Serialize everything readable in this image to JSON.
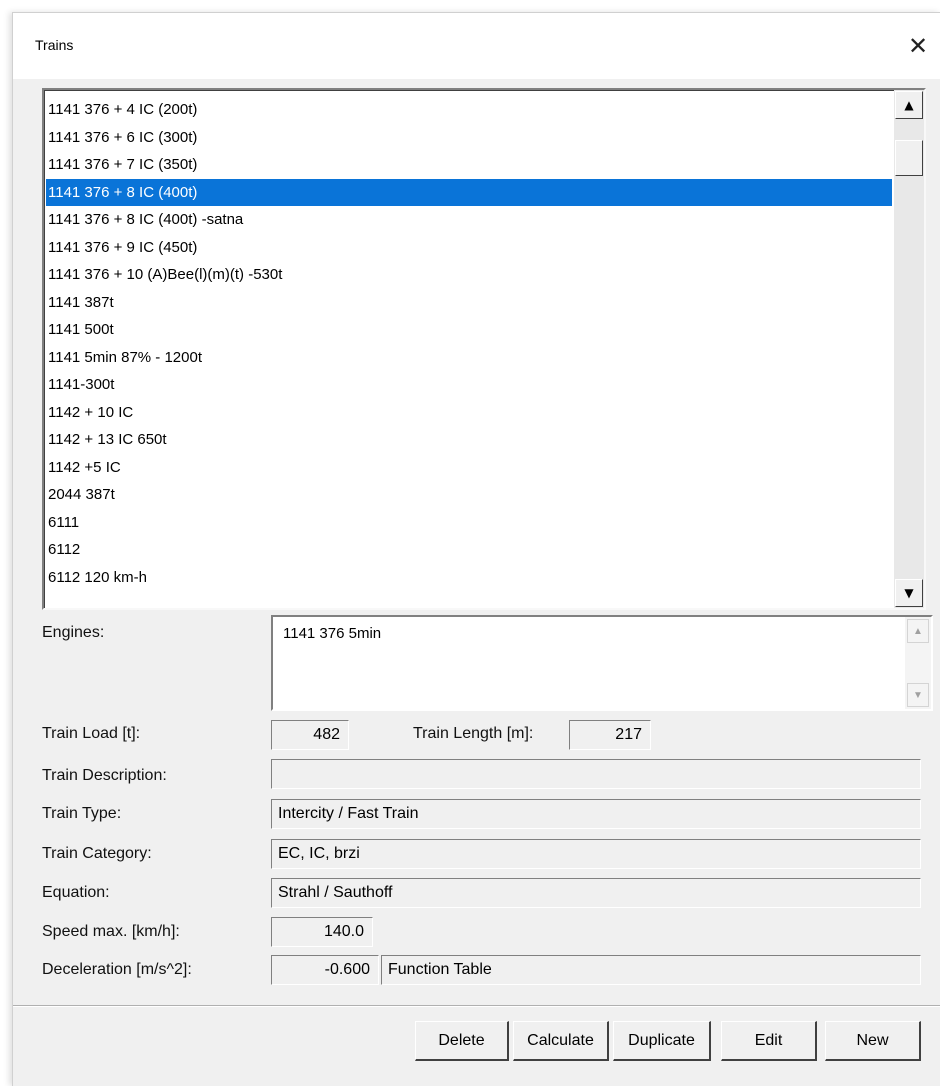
{
  "window": {
    "title": "Trains",
    "close_glyph": "✕"
  },
  "train_list": {
    "items": [
      "1141 376 + 4 IC (200t)",
      "1141 376 + 6 IC (300t)",
      "1141 376 + 7 IC (350t)",
      "1141 376 + 8 IC (400t)",
      "1141 376 + 8 IC (400t) -satna",
      "1141 376 + 9 IC (450t)",
      "1141 376 + 10 (A)Bee(l)(m)(t) -530t",
      "1141 387t",
      "1141 500t",
      "1141 5min 87% - 1200t",
      "1141-300t",
      "1142 + 10 IC",
      "1142 + 13 IC 650t",
      "1142 +5 IC",
      "2044 387t",
      "6111",
      "6112",
      "6112 120 km-h"
    ],
    "selected": "1141 376 + 8 IC (400t)",
    "scroll_up_glyph": "▲",
    "scroll_down_glyph": "▼"
  },
  "engines": {
    "label": "Engines:",
    "value": "1141 376 5min",
    "scroll_up_glyph": "▲",
    "scroll_down_glyph": "▼"
  },
  "train_load": {
    "label": "Train Load [t]:",
    "value": "482"
  },
  "train_length": {
    "label": "Train Length [m]:",
    "value": "217"
  },
  "train_description": {
    "label": "Train Description:",
    "value": ""
  },
  "train_type": {
    "label": "Train Type:",
    "value": "Intercity / Fast Train"
  },
  "train_category": {
    "label": "Train Category:",
    "value": "EC, IC, brzi"
  },
  "equation": {
    "label": "Equation:",
    "value": "Strahl / Sauthoff"
  },
  "speed_max": {
    "label": "Speed max. [km/h]:",
    "value": "140.0"
  },
  "deceleration": {
    "label": "Deceleration [m/s^2]:",
    "value": "-0.600",
    "mode": "Function Table"
  },
  "buttons": {
    "delete": "Delete",
    "calculate": "Calculate",
    "duplicate": "Duplicate",
    "edit": "Edit",
    "new": "New"
  },
  "colors": {
    "selection": "#0a74d8",
    "dialog_bg": "#f0f0f0"
  }
}
